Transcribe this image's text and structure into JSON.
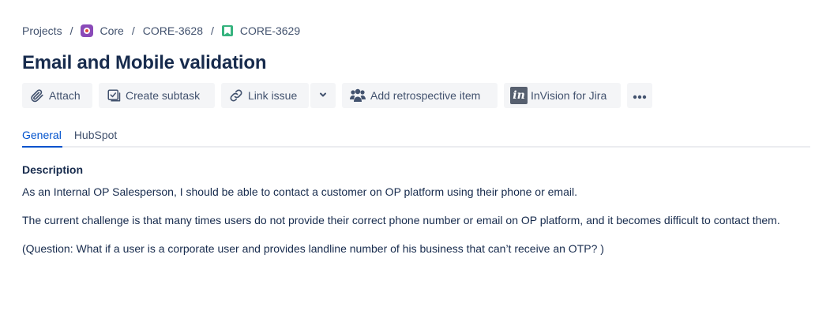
{
  "breadcrumb": {
    "projects": "Projects",
    "project": "Core",
    "parent": "CORE-3628",
    "issue": "CORE-3629",
    "separator": "/"
  },
  "issue": {
    "title": "Email and Mobile validation"
  },
  "toolbar": {
    "attach": "Attach",
    "create_subtask": "Create subtask",
    "link_issue": "Link issue",
    "retro": "Add retrospective item",
    "invision_logo": "in",
    "invision": "InVision for Jira"
  },
  "tabs": [
    {
      "label": "General",
      "active": true
    },
    {
      "label": "HubSpot",
      "active": false
    }
  ],
  "description": {
    "heading": "Description",
    "paragraphs": [
      "As an Internal OP Salesperson, I should be able to contact a customer on OP platform using their phone or email.",
      "The current challenge is that many times users do not provide their correct phone number or email on OP platform, and it becomes difficult to contact them.",
      "(Question: What if a user is a corporate user and provides landline number of his business that can’t receive an OTP? )"
    ]
  },
  "colors": {
    "link_blue": "#0052cc",
    "button_bg": "#f4f5f7",
    "text": "#172b4d",
    "subtle_text": "#42526e",
    "story_green": "#36b37e",
    "project_purple": "#8a4ab8"
  }
}
